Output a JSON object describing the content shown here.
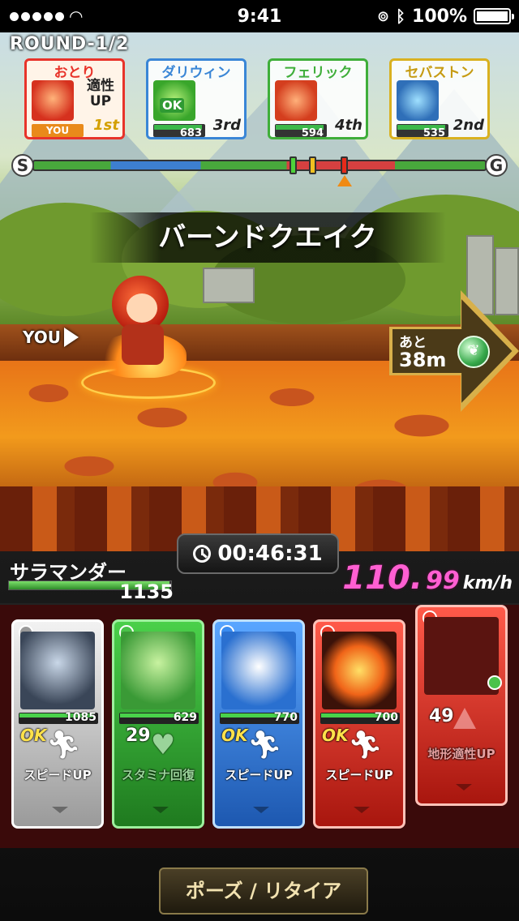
{
  "status_bar": {
    "time": "9:41",
    "battery": "100%"
  },
  "race": {
    "round": "ROUND-1/2",
    "skill_banner": "バーンドクエイク",
    "player_marker": "YOU",
    "distance_label": "あと",
    "distance_value": "38m",
    "timer": "00:46:31",
    "speed_int": "110.",
    "speed_dec": "99",
    "speed_unit": "km/h",
    "track": {
      "start": "S",
      "goal": "G"
    }
  },
  "racers": [
    {
      "name": "おとり",
      "aptitude": "適性UP",
      "you_tag": "YOU",
      "rank": "1st",
      "hp_fraction": 0.95
    },
    {
      "name": "ダリウィン",
      "badge": "OK",
      "hp": "683",
      "rank": "3rd",
      "hp_fraction": 0.95
    },
    {
      "name": "フェリック",
      "hp": "594",
      "rank": "4th",
      "hp_fraction": 0.95
    },
    {
      "name": "セバストン",
      "hp": "535",
      "rank": "2nd",
      "hp_fraction": 0.95
    }
  ],
  "monster": {
    "name": "サラマンダー",
    "hp": "1135",
    "hp_fraction": 1.0
  },
  "cards": [
    {
      "hp": "1085",
      "status": "OK",
      "skill": "スピードUP",
      "hp_fraction": 0.95
    },
    {
      "hp": "629",
      "count": "29",
      "skill": "スタミナ回復",
      "hp_fraction": 0.95
    },
    {
      "hp": "770",
      "status": "OK",
      "skill": "スピードUP",
      "hp_fraction": 0.95
    },
    {
      "hp": "700",
      "status": "OK",
      "skill": "スピードUP",
      "hp_fraction": 0.95
    },
    {
      "count": "49",
      "skill": "地形適性UP"
    }
  ],
  "pause_button": "ポーズ / リタイア",
  "colors": {
    "speed": "#ff5fd2",
    "player": "#e8332a"
  }
}
